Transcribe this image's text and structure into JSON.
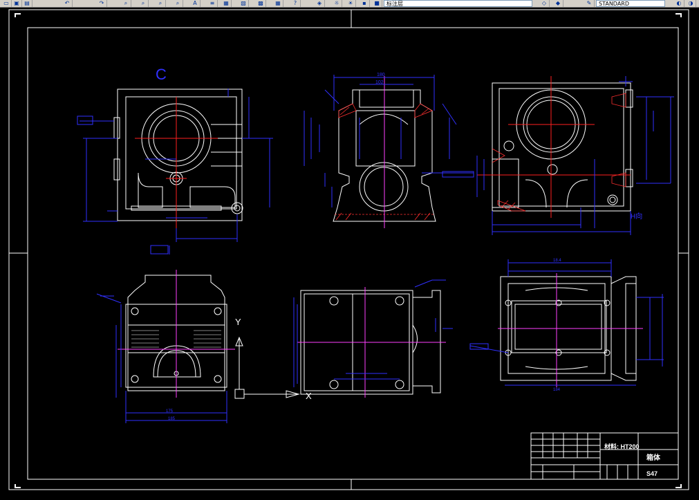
{
  "toolbar": {
    "buttons": [
      "open-icon",
      "save-icon",
      "print-icon",
      "undo-icon",
      "zoom-in-icon",
      "zoom-out-icon",
      "zoom-window-icon",
      "zoom-prev-icon",
      "text-style-icon",
      "layer-icon",
      "properties-icon",
      "grid-icon",
      "help-icon"
    ],
    "layer_value": "标注层",
    "style_value": "STANDARD"
  },
  "drawing": {
    "view_label_c": "C",
    "view_label_h": "H向",
    "ucs_x": "X",
    "ucs_y": "Y",
    "material_label": "材料: HT200",
    "part_name": "箱体",
    "part_code": "S47",
    "dims": {
      "top_width": "180",
      "top_inner": "102",
      "bottom_width": "175",
      "right_top": "18.4",
      "right_bottom": "42",
      "front_height": "160",
      "base_width": "185",
      "plan_width": "184",
      "plan_height": "100",
      "side_width": "120",
      "side_inner": "64",
      "r_width": "1.5",
      "height_right": "70"
    }
  },
  "colors": {
    "outline": "#ffffff",
    "dimension": "#3030ff",
    "centerline": "#ff2020",
    "symmetry": "#ff40ff",
    "hatch": "#ff3030",
    "frame": "#ffffff",
    "toolbar_bg": "#d4d0c8"
  }
}
